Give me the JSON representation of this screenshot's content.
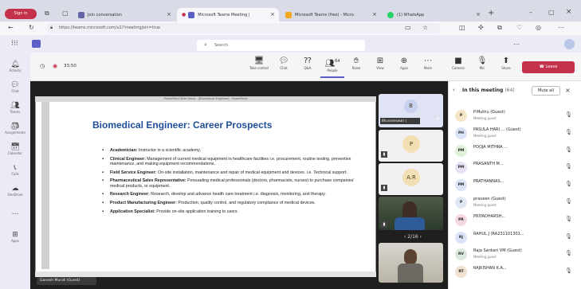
{
  "browser": {
    "profile_label": "Sign in",
    "tabs": [
      {
        "label": "Join conversation",
        "color": "#6264a7"
      },
      {
        "label": "Microsoft Teams Meeting |",
        "color": "#5b5fc7"
      },
      {
        "label": "Microsoft Teams (free) - Micro",
        "color": "#f2a81d"
      },
      {
        "label": "(1) WhatsApp",
        "color": "#25d366"
      }
    ],
    "new_tab": "+",
    "url": "https://teams.microsoft.com/v2/?meetingjoin=true"
  },
  "teams": {
    "search_placeholder": "Search",
    "rail": [
      "Activity",
      "Chat",
      "Teams",
      "Assignments",
      "Calendar",
      "Calls",
      "OneDrive",
      "...",
      "Apps"
    ],
    "timer": "33:50",
    "toolbar": [
      {
        "label": "Take control",
        "icon": "screen-icon"
      },
      {
        "label": "Chat",
        "icon": "chat-icon"
      },
      {
        "label": "Q&A",
        "icon": "qa-icon"
      },
      {
        "label": "People",
        "icon": "people-icon",
        "count": "64"
      },
      {
        "label": "Raise",
        "icon": "hand-icon"
      },
      {
        "label": "View",
        "icon": "view-icon"
      },
      {
        "label": "Apps",
        "icon": "apps-icon"
      },
      {
        "label": "More",
        "icon": "more-icon"
      },
      {
        "label": "Camera",
        "icon": "camera-icon"
      },
      {
        "label": "Mic",
        "icon": "mic-icon"
      },
      {
        "label": "Share",
        "icon": "share-icon"
      }
    ],
    "leave_label": "Leave",
    "leave_color": "#c4314b"
  },
  "share": {
    "window_title": "PowerPoint Slide Show - [Biomedical Engineer] - PowerPoint",
    "slide_title": "Biomedical Engineer: Career Prospects",
    "bullets": [
      {
        "head": "Academician:",
        "text": "Instructor in a scientific academy."
      },
      {
        "head": "Clinical Engineer:",
        "text": "Management of current medical equipment in healthcare facilities i.e. procurement, routine testing, preventive maintenance, and making equipment recommendations."
      },
      {
        "head": "Field Service Engineer:",
        "text": "On-site installation, maintenance and repair of medical equipment and devices. i.e. Technical support."
      },
      {
        "head": "Pharmaceutical Sales Representative:",
        "text": "Persuading medical professionals (doctors, pharmacists, nurses) to purchase companies' medical products, or equipment."
      },
      {
        "head": "Research Engineer:",
        "text": "Research, develop and advance health care treatment i.e. diagnosis, monitoring, and therapy."
      },
      {
        "head": "Product Manufacturing Engineer:",
        "text": "Production, quality control, and regulatory compliance of medical devices."
      },
      {
        "head": "Application Specialist:",
        "text": "Provide on-site application training to users."
      }
    ],
    "presenter_tag": "Ganesh Murali (Guest)"
  },
  "thumbnails": [
    {
      "initial": "B",
      "name": "Bhuvaneswari (",
      "type": "avatar"
    },
    {
      "initial": "P",
      "name": "",
      "type": "avatar"
    },
    {
      "initial": "A.R",
      "name": "",
      "type": "avatar"
    },
    {
      "initial": "",
      "name": "",
      "type": "video"
    },
    {
      "initial": "",
      "name": "",
      "type": "video"
    }
  ],
  "pager": "2/16",
  "panel": {
    "title": "In this meeting",
    "count": "(64)",
    "mute_all": "Mute all",
    "participants": [
      {
        "initials": "P",
        "name": "P.Muthu (Guest)",
        "sub": "Meeting guest",
        "color": "#f5e6c8"
      },
      {
        "initials": "PH",
        "name": "PASULA HARI ... (Guest)",
        "sub": "Meeting guest",
        "color": "#dbe3f7"
      },
      {
        "initials": "PM",
        "name": "POOJA MITHRA ...",
        "sub": "",
        "color": "#dff0d8"
      },
      {
        "initials": "PM",
        "name": "PRASANTH M...",
        "sub": "",
        "color": "#e8e0f5"
      },
      {
        "initials": "PM",
        "name": "PRATHANNAS...",
        "sub": "",
        "color": "#dbe3f7"
      },
      {
        "initials": "P",
        "name": "praveen (Guest)",
        "sub": "Meeting guest",
        "color": "#e1e8f5"
      },
      {
        "initials": "PR",
        "name": "PRIYADHARSH...",
        "sub": "",
        "color": "#f5d8e0"
      },
      {
        "initials": "RJ",
        "name": "RAHUL J (RA231101301...",
        "sub": "",
        "color": "#dbe3f7"
      },
      {
        "initials": "RV",
        "name": "Raja Sankari VM (Guest)",
        "sub": "Meeting guest",
        "color": "#dde8dd"
      },
      {
        "initials": "RT",
        "name": "RAJKISHAN K.A...",
        "sub": "",
        "color": "#f0e0d0"
      }
    ]
  }
}
